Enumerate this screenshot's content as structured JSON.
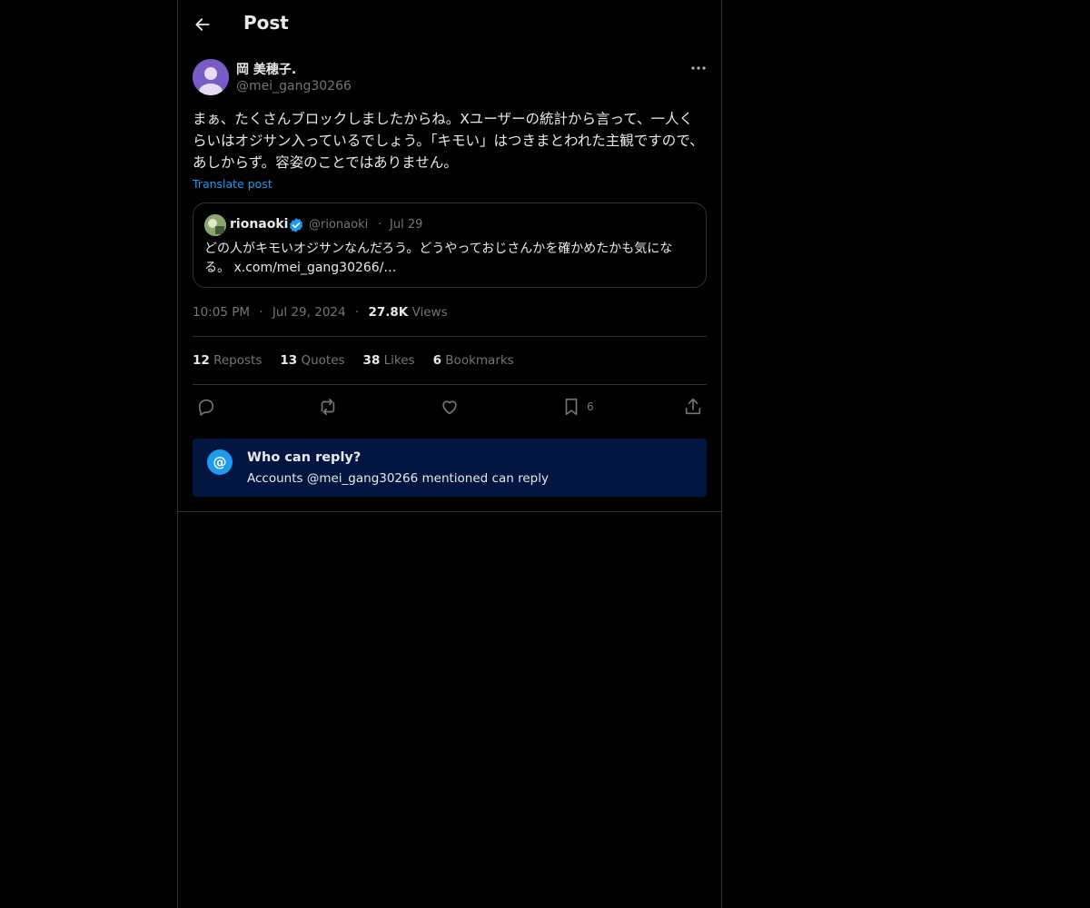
{
  "header": {
    "title": "Post"
  },
  "post": {
    "author_name": "岡 美穂子.",
    "author_handle": "@mei_gang30266",
    "text": "まぁ、たくさんブロックしましたからね。Xユーザーの統計から言って、一人くらいはオジサン入っているでしょう。「キモい」はつきまとわれた主観ですので、あしからず。容姿のことではありません。",
    "translate_label": "Translate post",
    "time": "10:05 PM",
    "date": "Jul 29, 2024",
    "views_count": "27.8K",
    "views_label": "Views",
    "separator": "·"
  },
  "quote": {
    "author_name": "rionaoki",
    "author_handle": "@rionaoki",
    "separator": "·",
    "date": "Jul 29",
    "text": "どの人がキモいオジサンなんだろう。どうやっておじさんかを確かめたかも気になる。",
    "link": "x.com/mei_gang30266/…"
  },
  "stats": [
    {
      "count": "12",
      "label": "Reposts"
    },
    {
      "count": "13",
      "label": "Quotes"
    },
    {
      "count": "38",
      "label": "Likes"
    },
    {
      "count": "6",
      "label": "Bookmarks"
    }
  ],
  "actions": {
    "bookmark_count": "6",
    "icons": [
      "reply-icon",
      "repost-icon",
      "like-icon",
      "bookmark-icon",
      "share-icon"
    ]
  },
  "reply_restriction": {
    "icon": "@",
    "title": "Who can reply?",
    "subtitle": "Accounts @mei_gang30266 mentioned can reply"
  },
  "colors": {
    "background": "#000000",
    "text_primary": "#e7e9ea",
    "text_secondary": "#71767b",
    "accent": "#1d9bf0",
    "border": "#2f3336",
    "reply_box_bg": "#031541"
  }
}
